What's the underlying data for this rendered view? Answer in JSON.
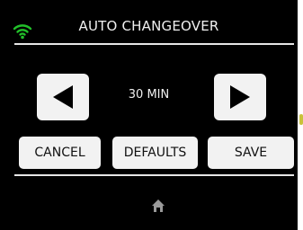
{
  "header": {
    "title": "AUTO CHANGEOVER",
    "wifi_icon": "wifi-icon",
    "wifi_color": "#22c02a"
  },
  "selector": {
    "value": "30 MIN",
    "left_icon": "arrow-left-icon",
    "right_icon": "arrow-right-icon"
  },
  "buttons": {
    "cancel": "CANCEL",
    "defaults": "DEFAULTS",
    "save": "SAVE"
  },
  "footer": {
    "home_icon": "home-icon"
  },
  "colors": {
    "screen_bg": "#000000",
    "button_bg": "#f2f2f2",
    "text_light": "#f0f0f0",
    "text_dark": "#111111",
    "icon_gray": "#9a9a9a"
  }
}
